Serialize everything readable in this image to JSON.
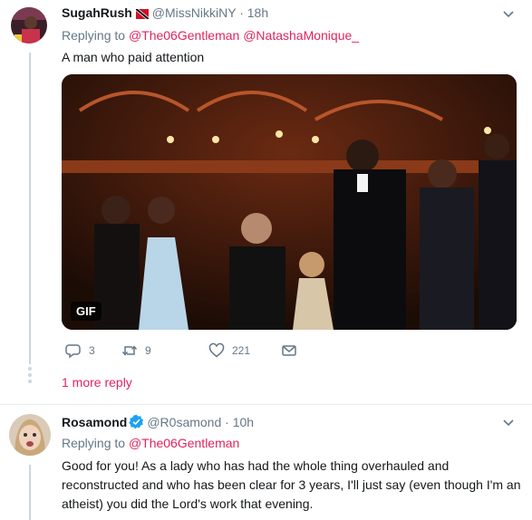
{
  "tweet1": {
    "name": "SugahRush",
    "handle": "@MissNikkiNY",
    "separator": "·",
    "time": "18h",
    "replying_prefix": "Replying to",
    "mentions": [
      "@The06Gentleman",
      "@NatashaMonique_"
    ],
    "text": "A man who paid attention",
    "media_badge": "GIF",
    "actions": {
      "reply_count": "3",
      "retweet_count": "9",
      "like_count": "221"
    },
    "more_replies": "1 more reply"
  },
  "tweet2": {
    "name": "Rosamond",
    "handle": "@R0samond",
    "separator": "·",
    "time": "10h",
    "replying_prefix": "Replying to",
    "mentions": [
      "@The06Gentleman"
    ],
    "text": "Good for you! As a lady who has had the whole thing overhauled and reconstructed and who has been clear for 3 years, I'll just say (even though I'm an atheist) you did the Lord's work that evening."
  },
  "colors": {
    "accent": "#e0245e",
    "muted": "#657786",
    "verified": "#1da1f2",
    "divider": "#e6ecf0"
  },
  "icons": {
    "reply": "reply-icon",
    "retweet": "retweet-icon",
    "like": "heart-icon",
    "dm": "envelope-icon",
    "caret": "chevron-down-icon",
    "verified": "verified-badge-icon",
    "flag": "trinidad-flag-icon"
  }
}
